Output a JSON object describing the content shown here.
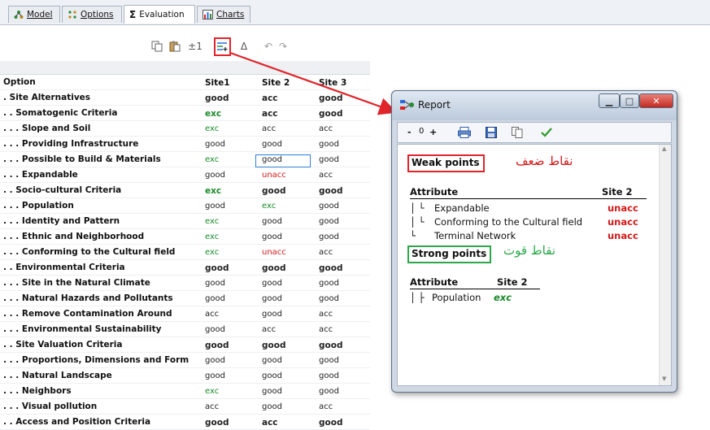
{
  "tabs": [
    {
      "label": "Model",
      "active": false
    },
    {
      "label": "Options",
      "active": false
    },
    {
      "label": "Evaluation",
      "active": true
    },
    {
      "label": "Charts",
      "active": false
    }
  ],
  "toolbar": {
    "plus_minus_one": "±1",
    "delta": "Δ"
  },
  "grid": {
    "headers": [
      "Option",
      "Site1",
      "Site 2",
      "Site 3"
    ],
    "rows": [
      {
        "option": ". Site Alternatives",
        "site1": "good",
        "site2": "acc",
        "site3": "good",
        "strong": true
      },
      {
        "option": ". . Somatogenic Criteria",
        "site1": "exc",
        "site2": "acc",
        "site3": "good",
        "strong": true
      },
      {
        "option": ". . . Slope and Soil",
        "site1": "exc",
        "site2": "acc",
        "site3": "acc",
        "strong": false
      },
      {
        "option": ". . . Providing Infrastructure",
        "site1": "good",
        "site2": "good",
        "site3": "good",
        "strong": false
      },
      {
        "option": ". . . Possible to Build & Materials",
        "site1": "exc",
        "site2": "good",
        "site3": "good",
        "strong": false
      },
      {
        "option": ". . . Expandable",
        "site1": "good",
        "site2": "unacc",
        "site3": "acc",
        "strong": false
      },
      {
        "option": ". . Socio-cultural Criteria",
        "site1": "exc",
        "site2": "good",
        "site3": "good",
        "strong": true
      },
      {
        "option": ". . . Population",
        "site1": "good",
        "site2": "exc",
        "site3": "good",
        "strong": false
      },
      {
        "option": ". . . Identity and Pattern",
        "site1": "exc",
        "site2": "good",
        "site3": "good",
        "strong": false
      },
      {
        "option": ". . . Ethnic and Neighborhood",
        "site1": "exc",
        "site2": "good",
        "site3": "good",
        "strong": false
      },
      {
        "option": ". . . Conforming to the Cultural field",
        "site1": "exc",
        "site2": "unacc",
        "site3": "acc",
        "strong": false
      },
      {
        "option": ". . Environmental Criteria",
        "site1": "good",
        "site2": "good",
        "site3": "good",
        "strong": true
      },
      {
        "option": ". . . Site in the Natural Climate",
        "site1": "good",
        "site2": "good",
        "site3": "good",
        "strong": false
      },
      {
        "option": ". . . Natural Hazards and Pollutants",
        "site1": "good",
        "site2": "good",
        "site3": "good",
        "strong": false
      },
      {
        "option": ". . . Remove Contamination Around",
        "site1": "acc",
        "site2": "good",
        "site3": "acc",
        "strong": false
      },
      {
        "option": ". . . Environmental Sustainability",
        "site1": "good",
        "site2": "acc",
        "site3": "acc",
        "strong": false
      },
      {
        "option": ". . Site Valuation Criteria",
        "site1": "good",
        "site2": "good",
        "site3": "good",
        "strong": true
      },
      {
        "option": ". . . Proportions, Dimensions and Form",
        "site1": "good",
        "site2": "good",
        "site3": "good",
        "strong": false
      },
      {
        "option": ". . . Natural Landscape",
        "site1": "good",
        "site2": "good",
        "site3": "good",
        "strong": false
      },
      {
        "option": ". . . Neighbors",
        "site1": "exc",
        "site2": "good",
        "site3": "good",
        "strong": false
      },
      {
        "option": ". . . Visual pollution",
        "site1": "acc",
        "site2": "good",
        "site3": "acc",
        "strong": false
      },
      {
        "option": ". . Access and Position Criteria",
        "site1": "good",
        "site2": "acc",
        "site3": "good",
        "strong": true
      }
    ]
  },
  "report": {
    "title": "Report",
    "toolbar": {
      "minus": "-",
      "zero": "0",
      "plus": "+"
    },
    "weak": {
      "label": "Weak points",
      "arabic": "نقاط ضعف",
      "attr_header": "Attribute",
      "site_header": "Site 2",
      "items": [
        {
          "prefix": "│  └",
          "name": "Expandable",
          "value": "unacc"
        },
        {
          "prefix": "│  └",
          "name": "Conforming to the Cultural field",
          "value": "unacc"
        },
        {
          "prefix": "   └",
          "name": "Terminal Network",
          "value": "unacc"
        }
      ]
    },
    "strong": {
      "label": "Strong points",
      "arabic": "نقاط قوت",
      "attr_header": "Attribute",
      "site_header": "Site 2",
      "items": [
        {
          "prefix": "│ ├",
          "name": "Population",
          "value": "exc"
        }
      ]
    }
  },
  "colors": {
    "exc": "#1a8a2a",
    "unacc": "#d21a1a",
    "highlight": "#e0242b",
    "strong_box": "#2aa84a",
    "focus": "#2f7fd8"
  }
}
